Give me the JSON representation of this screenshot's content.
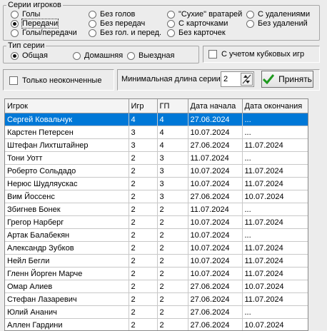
{
  "series_group": {
    "legend": "Серии игроков",
    "options": [
      {
        "label": "Голы",
        "checked": false
      },
      {
        "label": "Передачи",
        "checked": true
      },
      {
        "label": "Голы/передачи",
        "checked": false
      },
      {
        "label": "Без голов",
        "checked": false
      },
      {
        "label": "Без передач",
        "checked": false
      },
      {
        "label": "Без гол. и перед.",
        "checked": false
      },
      {
        "label": "\"Сухие\" вратарей",
        "checked": false
      },
      {
        "label": "С карточками",
        "checked": false
      },
      {
        "label": "Без карточек",
        "checked": false
      },
      {
        "label": "С удалениями",
        "checked": false
      },
      {
        "label": "Без удалений",
        "checked": false
      }
    ]
  },
  "type_group": {
    "legend": "Тип серии",
    "options": [
      {
        "label": "Общая",
        "checked": true
      },
      {
        "label": "Домашняя",
        "checked": false
      },
      {
        "label": "Выездная",
        "checked": false
      }
    ]
  },
  "cup_games_label": "С учетом кубковых игр",
  "unfinished_label": "Только неоконченные",
  "min_length_label": "Минимальная длина серии",
  "min_length_value": "2",
  "apply_label": "Принять",
  "colors": {
    "selection": "#0078d7",
    "apply_icon": "#1e9a1e"
  },
  "table": {
    "headers": [
      "Игрок",
      "Игр",
      "ГП",
      "Дата начала",
      "Дата окончания"
    ],
    "rows": [
      [
        "Сергей Ковальчук",
        "4",
        "4",
        "27.06.2024",
        "..."
      ],
      [
        "Карстен Петерсен",
        "3",
        "4",
        "10.07.2024",
        "..."
      ],
      [
        "Штефан Лихтштайнер",
        "3",
        "4",
        "27.06.2024",
        "11.07.2024"
      ],
      [
        "Тони Уотт",
        "2",
        "3",
        "11.07.2024",
        "..."
      ],
      [
        "Роберто Сольдадо",
        "2",
        "3",
        "10.07.2024",
        "11.07.2024"
      ],
      [
        "Нерюс Шудляускас",
        "2",
        "3",
        "10.07.2024",
        "11.07.2024"
      ],
      [
        "Вим Йоссенс",
        "2",
        "3",
        "27.06.2024",
        "10.07.2024"
      ],
      [
        "Збигнев Бонек",
        "2",
        "2",
        "11.07.2024",
        "..."
      ],
      [
        "Грегор Нарберг",
        "2",
        "2",
        "10.07.2024",
        "11.07.2024"
      ],
      [
        "Артак Балабекян",
        "2",
        "2",
        "10.07.2024",
        "..."
      ],
      [
        "Александр Зубков",
        "2",
        "2",
        "10.07.2024",
        "11.07.2024"
      ],
      [
        "Нейл Бегли",
        "2",
        "2",
        "10.07.2024",
        "11.07.2024"
      ],
      [
        "Гленн Йорген Марче",
        "2",
        "2",
        "10.07.2024",
        "11.07.2024"
      ],
      [
        "Омар Алиев",
        "2",
        "2",
        "27.06.2024",
        "10.07.2024"
      ],
      [
        "Стефан Лазаревич",
        "2",
        "2",
        "27.06.2024",
        "11.07.2024"
      ],
      [
        "Юлий Ананич",
        "2",
        "2",
        "27.06.2024",
        "..."
      ],
      [
        "Аллен Гардини",
        "2",
        "2",
        "27.06.2024",
        "10.07.2024"
      ]
    ],
    "selected_row": 0
  }
}
